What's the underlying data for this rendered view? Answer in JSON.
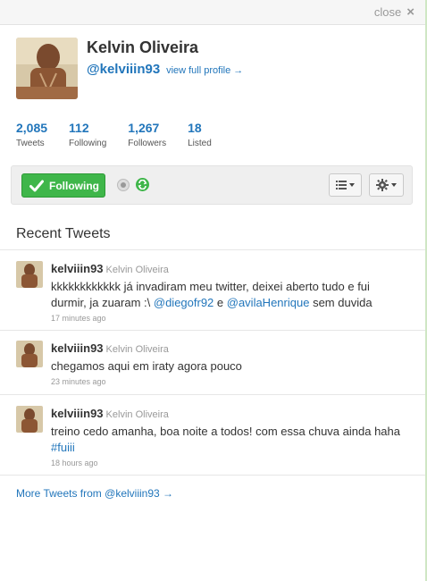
{
  "header": {
    "close_label": "close",
    "close_icon": "×"
  },
  "profile": {
    "full_name": "Kelvin Oliveira",
    "handle": "@kelviiin93",
    "view_profile": "view full profile →"
  },
  "stats": [
    {
      "value": "2,085",
      "label": "Tweets"
    },
    {
      "value": "112",
      "label": "Following"
    },
    {
      "value": "1,267",
      "label": "Followers"
    },
    {
      "value": "18",
      "label": "Listed"
    }
  ],
  "actions": {
    "follow_label": "Following",
    "accent": "#3fb64a",
    "link_color": "#2276bb"
  },
  "recent": {
    "title": "Recent Tweets",
    "tweets": [
      {
        "user": "kelviiin93",
        "name": "Kelvin Oliveira",
        "text_part1": "kkkkkkkkkkkk já invadiram meu twitter, deixei aberto tudo e fui durmir, ja zuaram :\\ ",
        "mention1": "@diegofr92",
        "text_part2": " e ",
        "mention2": "@avilaHenrique",
        "text_part3": " sem duvida",
        "time": "17 minutes ago"
      },
      {
        "user": "kelviiin93",
        "name": "Kelvin Oliveira",
        "text": "chegamos aqui em iraty agora pouco",
        "time": "23 minutes ago"
      },
      {
        "user": "kelviiin93",
        "name": "Kelvin Oliveira",
        "text": "treino cedo amanha, boa noite a todos! com essa chuva ainda haha ",
        "hashtag": "#fuiii",
        "time": "18 hours ago"
      }
    ],
    "more_link": "More Tweets from @kelviiin93 →"
  }
}
